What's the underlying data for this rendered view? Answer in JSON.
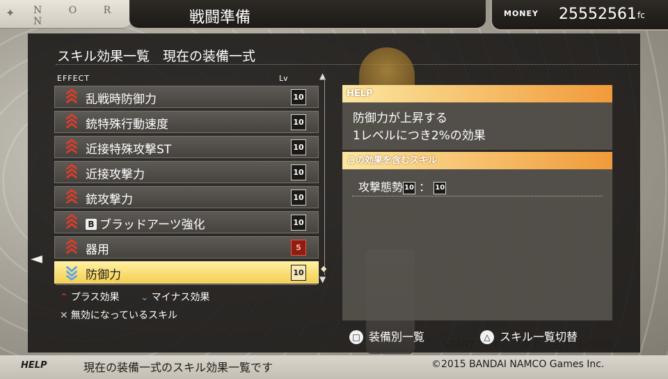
{
  "header": {
    "logo": "N O R N",
    "title": "戦闘準備",
    "money_label": "MONEY",
    "money_value": "25552561",
    "money_unit": "fc"
  },
  "panel": {
    "title": "スキル効果一覧　現在の装備一式",
    "col_effect": "EFFECT",
    "col_lv": "Lv"
  },
  "effects": [
    {
      "name": "乱戦時防御力",
      "lv": "10",
      "dir": "plus"
    },
    {
      "name": "銃特殊行動速度",
      "lv": "10",
      "dir": "plus"
    },
    {
      "name": "近接特殊攻撃ST",
      "lv": "10",
      "dir": "plus"
    },
    {
      "name": "近接攻撃力",
      "lv": "10",
      "dir": "plus"
    },
    {
      "name": "銃攻撃力",
      "lv": "10",
      "dir": "plus"
    },
    {
      "badge": "B",
      "name": "ブラッドアーツ強化",
      "lv": "10",
      "dir": "plus"
    },
    {
      "name": "器用",
      "lv": "5",
      "dir": "plus"
    },
    {
      "name": "防御力",
      "lv": "10",
      "dir": "minus"
    }
  ],
  "legend": {
    "plus": "プラス効果",
    "minus": "マイナス効果",
    "disabled": "無効になっているスキル"
  },
  "help": {
    "header": "HELP",
    "line1": "防御力が上昇する",
    "line2": "1レベルにつき2%の効果"
  },
  "skills": {
    "header": "この効果を含むスキル",
    "name": "攻撃態勢",
    "lv1": "10",
    "sep": "：",
    "lv2": "10"
  },
  "buttons": {
    "square_label": "装備別一覧",
    "triangle_label": "スキル一覧切替",
    "ghost": "START スキルリスト　モデルの回転"
  },
  "footer": {
    "help_tag": "HELP",
    "message": "現在の装備一式のスキル効果一覧です",
    "copyright": "©2015 BANDAI NAMCO Games Inc."
  },
  "colors": {
    "accent_orange": "#f19a3a",
    "selected_row": "#f5cf52",
    "plus_icon": "#e03b2a",
    "minus_icon": "#5fa3e8"
  }
}
